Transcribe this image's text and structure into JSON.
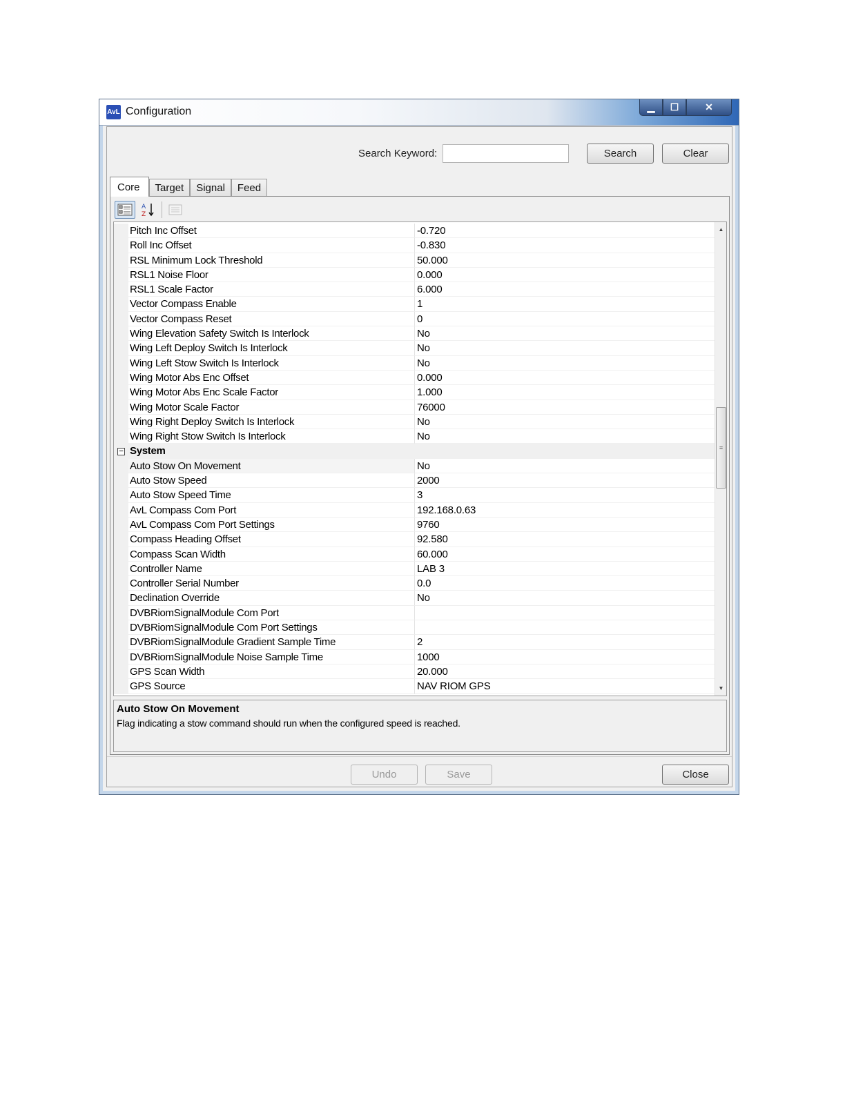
{
  "window": {
    "title": "Configuration",
    "app_icon": "AvL",
    "controls": {
      "minimize": "▁",
      "maximize": "☐",
      "close": "✕"
    }
  },
  "search": {
    "label": "Search Keyword:",
    "value": "",
    "search_button": "Search",
    "clear_button": "Clear"
  },
  "tabs": [
    "Core",
    "Target",
    "Signal",
    "Feed"
  ],
  "toolbar": {
    "categorized_icon": "categorized-view-icon",
    "alphabetical_icon": "alphabetical-sort-icon",
    "property_pages_icon": "property-pages-icon"
  },
  "properties": {
    "rows_top": [
      {
        "name": "Pitch Inc Offset",
        "value": "-0.720"
      },
      {
        "name": "Roll Inc Offset",
        "value": "-0.830"
      },
      {
        "name": "RSL Minimum Lock Threshold",
        "value": "50.000"
      },
      {
        "name": "RSL1 Noise Floor",
        "value": "0.000"
      },
      {
        "name": "RSL1 Scale Factor",
        "value": "6.000"
      },
      {
        "name": "Vector Compass Enable",
        "value": "1"
      },
      {
        "name": "Vector Compass Reset",
        "value": "0"
      },
      {
        "name": "Wing Elevation Safety Switch Is Interlock",
        "value": "No"
      },
      {
        "name": "Wing Left Deploy Switch Is Interlock",
        "value": "No"
      },
      {
        "name": "Wing Left Stow Switch Is Interlock",
        "value": "No"
      },
      {
        "name": "Wing Motor Abs Enc Offset",
        "value": "0.000"
      },
      {
        "name": "Wing Motor Abs Enc Scale Factor",
        "value": "1.000"
      },
      {
        "name": "Wing Motor Scale Factor",
        "value": "76000"
      },
      {
        "name": "Wing Right Deploy Switch Is Interlock",
        "value": "No"
      },
      {
        "name": "Wing Right Stow Switch Is Interlock",
        "value": "No"
      }
    ],
    "category": {
      "name": "System",
      "toggle": "−"
    },
    "rows_system": [
      {
        "name": "Auto Stow On Movement",
        "value": "No"
      },
      {
        "name": "Auto Stow Speed",
        "value": "2000"
      },
      {
        "name": "Auto Stow Speed Time",
        "value": "3"
      },
      {
        "name": "AvL Compass Com Port",
        "value": "192.168.0.63"
      },
      {
        "name": "AvL Compass Com Port Settings",
        "value": "9760"
      },
      {
        "name": "Compass Heading Offset",
        "value": "92.580"
      },
      {
        "name": "Compass Scan Width",
        "value": "60.000"
      },
      {
        "name": "Controller Name",
        "value": "LAB 3"
      },
      {
        "name": "Controller Serial Number",
        "value": "0.0"
      },
      {
        "name": "Declination Override",
        "value": "No"
      },
      {
        "name": "DVBRiomSignalModule Com Port",
        "value": ""
      },
      {
        "name": "DVBRiomSignalModule Com Port Settings",
        "value": ""
      },
      {
        "name": "DVBRiomSignalModule Gradient Sample Time",
        "value": "2"
      },
      {
        "name": "DVBRiomSignalModule Noise Sample Time",
        "value": "1000"
      },
      {
        "name": "GPS Scan Width",
        "value": "20.000"
      },
      {
        "name": "GPS Source",
        "value": "NAV RIOM GPS"
      }
    ]
  },
  "help": {
    "title": "Auto Stow On Movement",
    "description": "Flag indicating a stow command should run when the configured speed is reached."
  },
  "footer": {
    "undo": "Undo",
    "save": "Save",
    "close": "Close"
  }
}
